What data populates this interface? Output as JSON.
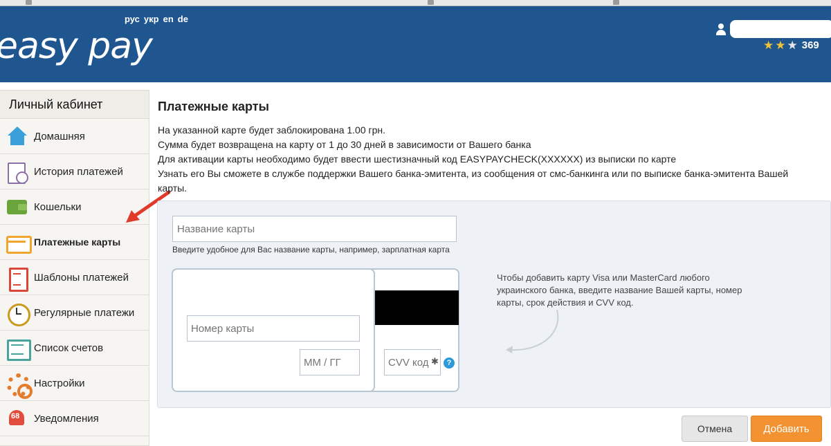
{
  "header": {
    "logo_text": "easy pay",
    "languages": [
      "рус",
      "укр",
      "en",
      "de"
    ],
    "rating": "369",
    "stars": 2
  },
  "sidebar": {
    "title": "Личный кабинет",
    "items": [
      {
        "label": "Домашняя",
        "icon": "home-icon"
      },
      {
        "label": "История платежей",
        "icon": "history-icon"
      },
      {
        "label": "Кошельки",
        "icon": "wallet-icon"
      },
      {
        "label": "Платежные карты",
        "icon": "card-icon",
        "active": true
      },
      {
        "label": "Шаблоны платежей",
        "icon": "templates-icon"
      },
      {
        "label": "Регулярные платежи",
        "icon": "alarm-clock-icon"
      },
      {
        "label": "Список счетов",
        "icon": "accounts-list-icon"
      },
      {
        "label": "Настройки",
        "icon": "settings-gears-icon"
      },
      {
        "label": "Уведомления",
        "icon": "notification-bell-icon"
      }
    ]
  },
  "main": {
    "title": "Платежные карты",
    "info_lines": [
      "На указанной карте будет заблокирована 1.00 грн.",
      "Сумма будет возвращена на карту от 1 до 30 дней в зависимости от Вашего банка",
      "Для активации карты необходимо будет ввести шестизначный код EASYPAYCHECK(XXXXXX) из выписки по карте",
      "Узнать его Вы сможете в службе поддержки Вашего банка-эмитента, из сообщения от смс-банкинга или по выписке банка-эмитента Вашей карты."
    ],
    "form": {
      "card_name_placeholder": "Название карты",
      "card_name_hint": "Введите удобное для Вас название карты, например, зарплатная карта",
      "card_number_placeholder": "Номер карты",
      "expiry_placeholder": "ММ / ГГ",
      "cvv_placeholder": "CVV код",
      "side_hint": "Чтобы добавить карту Visa или MasterCard любого украинского банка, введите название Вашей карты, номер карты, срок действия и CVV код.",
      "help_symbol": "?"
    },
    "buttons": {
      "cancel": "Отмена",
      "add": "Добавить"
    }
  },
  "colors": {
    "header_bg": "#20568f",
    "accent_orange": "#f29230",
    "panel_bg": "#eef2f6"
  }
}
